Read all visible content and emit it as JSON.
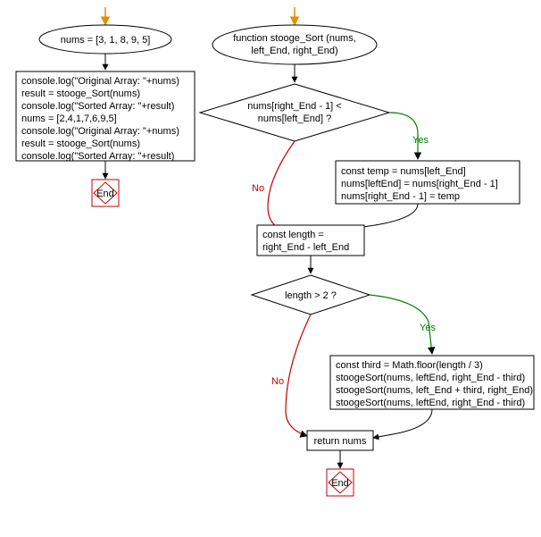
{
  "left": {
    "start_arrow": true,
    "oval_text": "nums = [3, 1, 8, 9, 5]",
    "code_lines": [
      "console.log(\"Original Array: \"+nums)",
      "result = stooge_Sort(nums)",
      "console.log(\"Sorted Array: \"+result)",
      "nums = [2,4,1,7,6,9,5]",
      "console.log(\"Original Array: \"+nums)",
      "result = stooge_Sort(nums)",
      "console.log(\"Sorted Array: \"+result)"
    ],
    "end_label": "End"
  },
  "right": {
    "start_arrow": true,
    "func_oval_lines": [
      "function stooge_Sort (nums,",
      "left_End, right_End)"
    ],
    "diamond1_lines": [
      "nums[right_End - 1] <",
      "nums[left_End] ?"
    ],
    "diamond1_yes": "Yes",
    "diamond1_no": "No",
    "swap_lines": [
      "const temp = nums[left_End]",
      "nums[leftEnd] = nums[right_End - 1]",
      "nums[right_End - 1] = temp"
    ],
    "length_lines": [
      "const length =",
      "right_End - left_End"
    ],
    "diamond2_text": "length > 2 ?",
    "diamond2_yes": "Yes",
    "diamond2_no": "No",
    "recurse_lines": [
      "const third = Math.floor(length / 3)",
      "stoogeSort(nums, leftEnd, right_End - third)",
      "stoogeSort(nums, left_End + third, right_End)",
      "stoogeSort(nums, leftEnd, right_End - third)"
    ],
    "return_text": "return nums",
    "end_label": "End"
  }
}
